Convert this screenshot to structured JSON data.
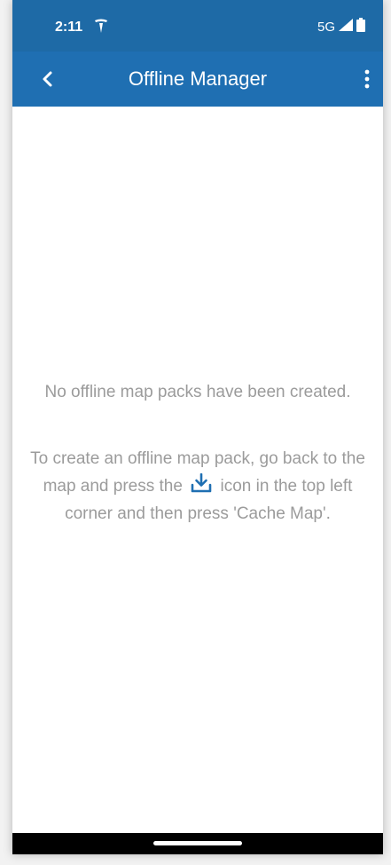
{
  "status": {
    "time": "2:11",
    "network": "5G",
    "carrier_icon": "tesla-icon",
    "signal_icon": "signal-icon",
    "battery_icon": "battery-icon"
  },
  "app_bar": {
    "title": "Offline Manager",
    "back_icon": "chevron-left-icon",
    "menu_icon": "more-vert-icon",
    "color": "#1f6fb2"
  },
  "empty_state": {
    "title": "No offline map packs have been created.",
    "help_part1": "To create an offline map pack, go back to the map and press the",
    "help_icon": "download-icon",
    "help_part2": "icon in the top left corner and then press 'Cache Map'.",
    "text_color": "#9b9b9b"
  }
}
